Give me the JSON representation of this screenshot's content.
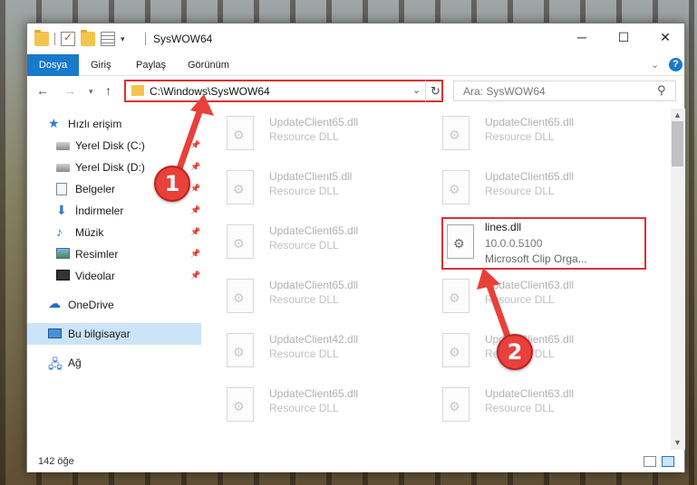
{
  "window": {
    "title": "SysWOW64",
    "minimize_glyph": "─",
    "maximize_glyph": "☐",
    "close_glyph": "✕"
  },
  "ribbon": {
    "tabs": [
      "Dosya",
      "Giriş",
      "Paylaş",
      "Görünüm"
    ],
    "help_glyph": "?",
    "collapse_glyph": "⌄"
  },
  "nav": {
    "back_glyph": "←",
    "forward_glyph": "→",
    "recent_glyph": "▾",
    "up_glyph": "↑",
    "address": "C:\\Windows\\SysWOW64",
    "address_dropdown_glyph": "⌄",
    "refresh_glyph": "↻",
    "search_placeholder": "Ara: SysWOW64",
    "search_glyph": "⚲"
  },
  "sidebar": {
    "items": [
      {
        "label": "Hızlı erişim",
        "icon": "star-icon",
        "pinned": false
      },
      {
        "label": "Yerel Disk (C:)",
        "icon": "disk-icon",
        "pinned": true
      },
      {
        "label": "Yerel Disk (D:)",
        "icon": "disk-icon",
        "pinned": true
      },
      {
        "label": "Belgeler",
        "icon": "documents-icon",
        "pinned": true
      },
      {
        "label": "İndirmeler",
        "icon": "downloads-icon",
        "pinned": true
      },
      {
        "label": "Müzik",
        "icon": "music-icon",
        "pinned": true
      },
      {
        "label": "Resimler",
        "icon": "pictures-icon",
        "pinned": true
      },
      {
        "label": "Videolar",
        "icon": "videos-icon",
        "pinned": true
      },
      {
        "label": "OneDrive",
        "icon": "onedrive-icon",
        "pinned": false
      },
      {
        "label": "Bu bilgisayar",
        "icon": "computer-icon",
        "pinned": false,
        "selected": true
      },
      {
        "label": "Ağ",
        "icon": "network-icon",
        "pinned": false
      }
    ],
    "pin_glyph": "📌"
  },
  "files": [
    {
      "name": "UpdateClient65.dll",
      "desc": "Resource DLL"
    },
    {
      "name": "UpdateClient65.dll",
      "desc": "Resource DLL"
    },
    {
      "name": "UpdateClient5.dll",
      "desc": "Resource DLL"
    },
    {
      "name": "UpdateClient65.dll",
      "desc": "Resource DLL"
    },
    {
      "name": "UpdateClient65.dll",
      "desc": "Resource DLL"
    },
    {
      "name": "lines.dll",
      "desc": "10.0.0.5100",
      "extra": "Microsoft Clip Orga...",
      "highlighted": true
    },
    {
      "name": "UpdateClient65.dll",
      "desc": "Resource DLL"
    },
    {
      "name": "UpdateClient63.dll",
      "desc": "Resource DLL"
    },
    {
      "name": "UpdateClient42.dll",
      "desc": "Resource DLL"
    },
    {
      "name": "UpdateClient65.dll",
      "desc": "Resource DLL"
    },
    {
      "name": "UpdateClient65.dll",
      "desc": "Resource DLL"
    },
    {
      "name": "UpdateClient63.dll",
      "desc": "Resource DLL"
    }
  ],
  "status": {
    "item_count": "142 öğe"
  },
  "annotations": {
    "callout_1": "1",
    "callout_2": "2",
    "highlight_color": "#e03030",
    "callout_color": "#e8403a"
  },
  "colors": {
    "accent": "#1979ca",
    "selection": "#cce4f7"
  }
}
